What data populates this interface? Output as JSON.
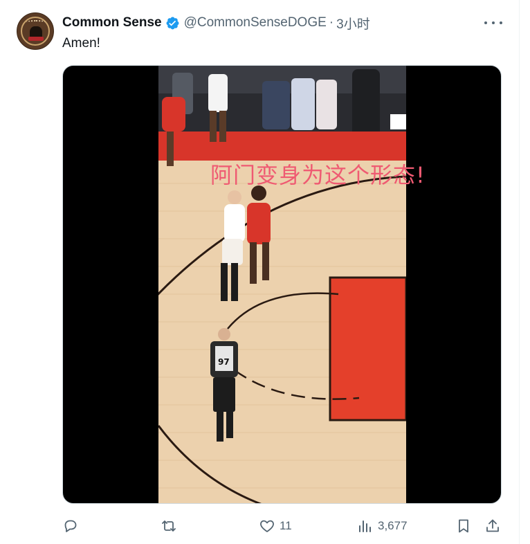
{
  "tweet": {
    "author": {
      "display_name": "Common Sense",
      "handle": "@CommonSenseDOGE",
      "verified": true,
      "avatar_icon": "dog-badge-avatar"
    },
    "separator": "·",
    "time": "3小时",
    "text": "Amen!",
    "media": {
      "type": "video",
      "overlay_caption": "阿门变身为这个形态!",
      "referee_number": "97"
    },
    "actions": {
      "reply": {
        "icon": "reply-icon",
        "count": ""
      },
      "retweet": {
        "icon": "retweet-icon",
        "count": ""
      },
      "like": {
        "icon": "heart-icon",
        "count": "11"
      },
      "views": {
        "icon": "views-chart-icon",
        "count": "3,677"
      },
      "bookmark": {
        "icon": "bookmark-icon"
      },
      "share": {
        "icon": "share-icon"
      }
    },
    "colors": {
      "verified_badge": "#1d9bf0",
      "secondary_text": "#536471",
      "caption_text": "#ef5a72",
      "court_paint": "#e4402b"
    }
  }
}
